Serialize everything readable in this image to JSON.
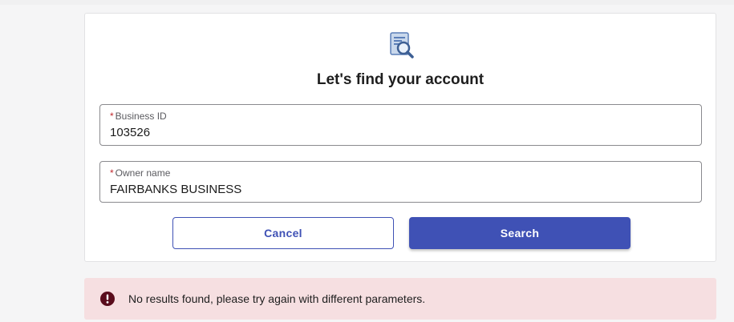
{
  "colors": {
    "accent": "#3f51b5",
    "required": "#c0282d",
    "alert_bg": "#f6dfe1",
    "alert_icon": "#5a0c1c"
  },
  "card": {
    "icon": "search-document-icon",
    "title": "Let's find your account"
  },
  "form": {
    "business_id": {
      "required_marker": "*",
      "label": "Business ID",
      "value": "103526"
    },
    "owner_name": {
      "required_marker": "*",
      "label": "Owner name",
      "value": "FAIRBANKS BUSINESS"
    }
  },
  "buttons": {
    "cancel_label": "Cancel",
    "search_label": "Search"
  },
  "alert": {
    "icon": "exclamation-icon",
    "message": "No results found, please try again with different parameters."
  }
}
